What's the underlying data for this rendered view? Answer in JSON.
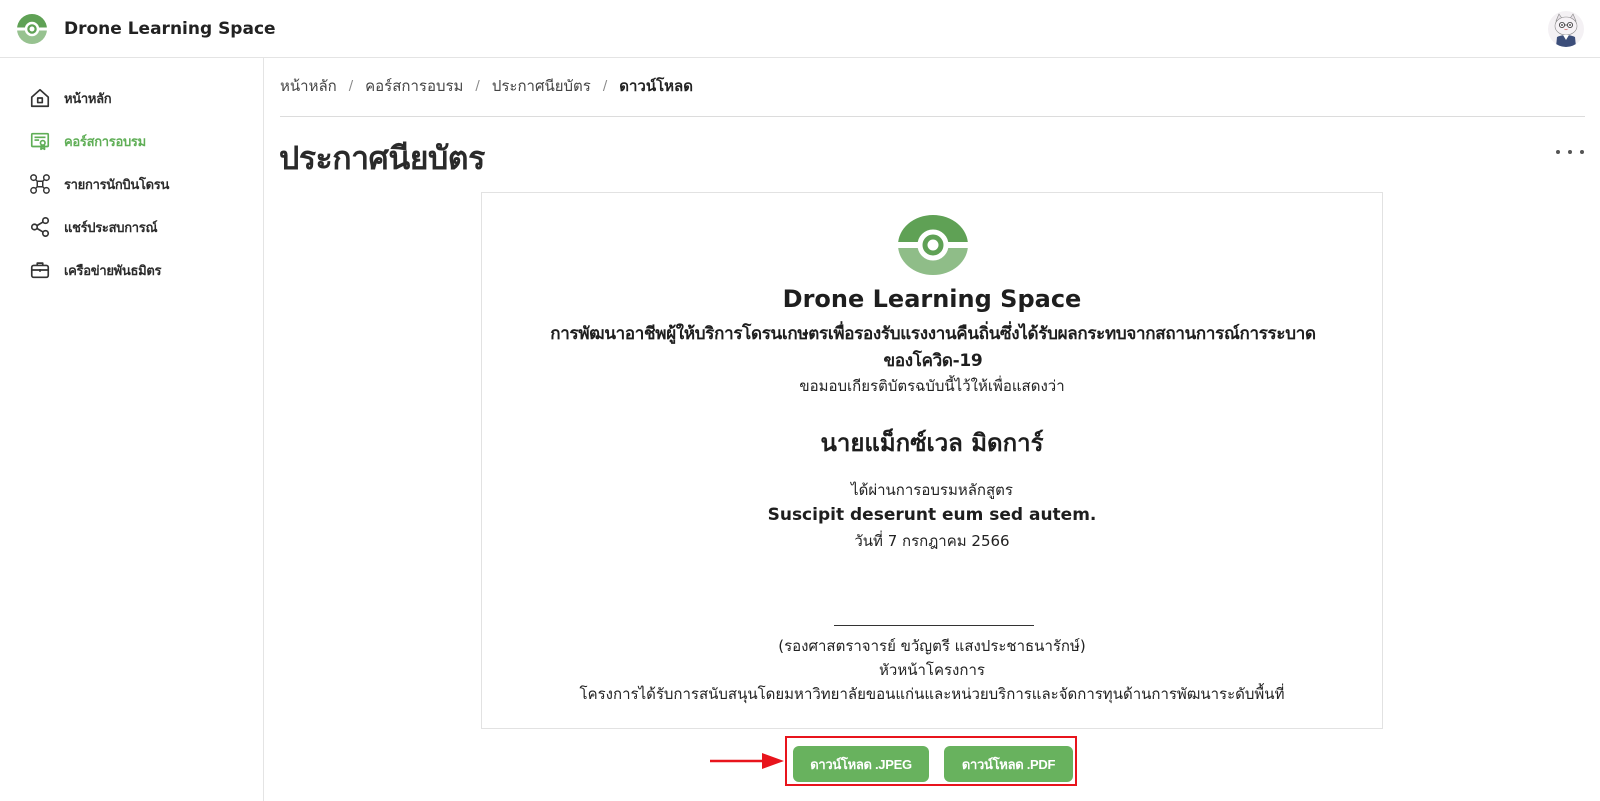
{
  "app": {
    "name": "Drone Learning Space",
    "brand_color": "#5fa155"
  },
  "sidebar": {
    "items": [
      {
        "label": "หน้าหลัก",
        "icon": "home-icon",
        "active": false
      },
      {
        "label": "คอร์สการอบรม",
        "icon": "certificate-icon",
        "active": true
      },
      {
        "label": "รายการนักบินโดรน",
        "icon": "drone-icon",
        "active": false
      },
      {
        "label": "แชร์ประสบการณ์",
        "icon": "share-icon",
        "active": false
      },
      {
        "label": "เครือข่ายพันธมิตร",
        "icon": "briefcase-icon",
        "active": false
      }
    ]
  },
  "breadcrumb": [
    "หน้าหลัก",
    "คอร์สการอบรม",
    "ประกาศนียบัตร",
    "ดาวน์โหลด"
  ],
  "breadcrumb_separator": "/",
  "page": {
    "title": "ประกาศนียบัตร"
  },
  "certificate": {
    "brand": "Drone Learning Space",
    "project_line1": "การพัฒนาอาชีพผู้ให้บริการโดรนเกษตรเพื่อรองรับแรงงานคืนถิ่นซึ่งได้รับผลกระทบจากสถานการณ์การระบาด",
    "project_line2": "ของโควิด-19",
    "intro": "ขอมอบเกียรติบัตรฉบับนี้ไว้ให้เพื่อแสดงว่า",
    "recipient": "นายแม็กซ์เวล มิดการ์",
    "passed": "ได้ผ่านการอบรมหลักสูตร",
    "course": "Suscipit deserunt eum sed autem.",
    "date": "วันที่ 7 กรกฎาคม 2566",
    "signer": "(รองศาสตราจารย์ ขวัญตรี แสงประชาธนารักษ์)",
    "signer_title": "หัวหน้าโครงการ",
    "sponsor": "โครงการได้รับการสนับสนุนโดยมหาวิทยาลัยขอนแก่นและหน่วยบริการและจัดการทุนด้านการพัฒนาระดับพื้นที่"
  },
  "actions": {
    "download_jpeg": "ดาวน์โหลด .JPEG",
    "download_pdf": "ดาวน์โหลด .PDF"
  },
  "colors": {
    "accent": "#68b25e",
    "highlight": "#e8141c"
  }
}
